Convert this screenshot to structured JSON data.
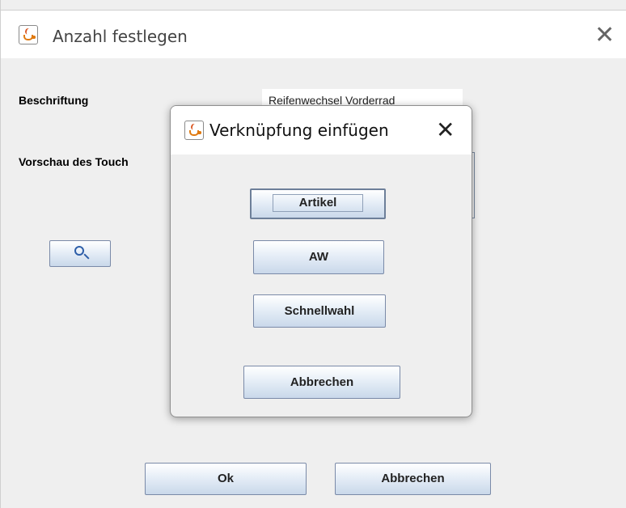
{
  "window": {
    "title": "Anzahl festlegen",
    "icon": "java-cup-icon",
    "close_symbol": "✕"
  },
  "form": {
    "beschriftung_label": "Beschriftung",
    "beschriftung_value": "Reifenwechsel Vorderrad",
    "vorschau_label": "Vorschau des Touch",
    "search_icon": "magnifier-icon"
  },
  "footer": {
    "ok_label": "Ok",
    "cancel_label": "Abbrechen"
  },
  "dialog": {
    "title": "Verknüpfung einfügen",
    "icon": "java-cup-icon",
    "close_symbol": "✕",
    "buttons": [
      "Artikel",
      "AW",
      "Schnellwahl"
    ],
    "cancel_label": "Abbrechen"
  },
  "colors": {
    "window_bg": "#efefef",
    "titlebar_bg": "#ffffff",
    "button_gradient_top": "#ffffff",
    "button_gradient_bottom": "#c9d8ea",
    "button_border": "#7a8aa8"
  }
}
